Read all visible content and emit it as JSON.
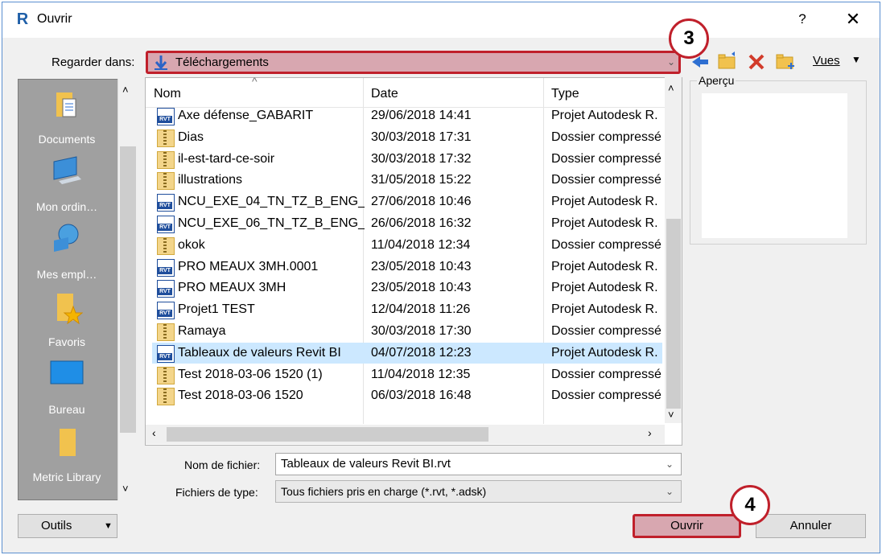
{
  "window": {
    "app_icon": "R",
    "title": "Ouvrir",
    "help_glyph": "?",
    "close_glyph": "✕"
  },
  "lookin": {
    "label": "Regarder dans:",
    "value": "Téléchargements",
    "icon": "download-arrow-icon"
  },
  "toolbar": {
    "views_label": "Vues",
    "icons": [
      "back-arrow-icon",
      "up-folder-icon",
      "delete-icon",
      "new-folder-icon"
    ]
  },
  "annotations": {
    "step3": "3",
    "step4": "4"
  },
  "places": [
    {
      "label": "Documents",
      "icon": "documents-icon"
    },
    {
      "label": "Mon ordin…",
      "icon": "computer-icon"
    },
    {
      "label": "Mes empl…",
      "icon": "network-icon"
    },
    {
      "label": "Favoris",
      "icon": "favorites-icon"
    },
    {
      "label": "Bureau",
      "icon": "desktop-icon"
    },
    {
      "label": "Metric Library",
      "icon": "folder-icon"
    }
  ],
  "filelist": {
    "columns": [
      "Nom",
      "Date",
      "Type"
    ],
    "sort_indicator": "^",
    "rows": [
      {
        "name": "Axe défense_GABARIT",
        "date": "29/06/2018 14:41",
        "type": "Projet Autodesk R.",
        "icon": "rvt",
        "selected": false
      },
      {
        "name": "Dias",
        "date": "30/03/2018 17:31",
        "type": "Dossier compressé",
        "icon": "zip",
        "selected": false
      },
      {
        "name": "il-est-tard-ce-soir",
        "date": "30/03/2018 17:32",
        "type": "Dossier compressé",
        "icon": "zip",
        "selected": false
      },
      {
        "name": "illustrations",
        "date": "31/05/2018 15:22",
        "type": "Dossier compressé",
        "icon": "zip",
        "selected": false
      },
      {
        "name": "NCU_EXE_04_TN_TZ_B_ENG_...",
        "date": "27/06/2018 10:46",
        "type": "Projet Autodesk R.",
        "icon": "rvt",
        "selected": false
      },
      {
        "name": "NCU_EXE_06_TN_TZ_B_ENG_...",
        "date": "26/06/2018 16:32",
        "type": "Projet Autodesk R.",
        "icon": "rvt",
        "selected": false
      },
      {
        "name": "okok",
        "date": "11/04/2018 12:34",
        "type": "Dossier compressé",
        "icon": "zip",
        "selected": false
      },
      {
        "name": "PRO MEAUX 3MH.0001",
        "date": "23/05/2018 10:43",
        "type": "Projet Autodesk R.",
        "icon": "rvt",
        "selected": false
      },
      {
        "name": "PRO MEAUX 3MH",
        "date": "23/05/2018 10:43",
        "type": "Projet Autodesk R.",
        "icon": "rvt",
        "selected": false
      },
      {
        "name": "Projet1 TEST",
        "date": "12/04/2018 11:26",
        "type": "Projet Autodesk R.",
        "icon": "rvt",
        "selected": false
      },
      {
        "name": "Ramaya",
        "date": "30/03/2018 17:30",
        "type": "Dossier compressé",
        "icon": "zip",
        "selected": false
      },
      {
        "name": "Tableaux de valeurs Revit BI",
        "date": "04/07/2018 12:23",
        "type": "Projet Autodesk R.",
        "icon": "rvt",
        "selected": true
      },
      {
        "name": "Test 2018-03-06 1520 (1)",
        "date": "11/04/2018 12:35",
        "type": "Dossier compressé",
        "icon": "zip",
        "selected": false
      },
      {
        "name": "Test 2018-03-06 1520",
        "date": "06/03/2018 16:48",
        "type": "Dossier compressé",
        "icon": "zip",
        "selected": false
      }
    ]
  },
  "preview": {
    "label": "Aperçu"
  },
  "filename": {
    "label": "Nom de fichier:",
    "value": "Tableaux de valeurs Revit BI.rvt"
  },
  "filetype": {
    "label": "Fichiers de type:",
    "value": "Tous fichiers pris en charge  (*.rvt, *.adsk)"
  },
  "buttons": {
    "tools": "Outils",
    "open": "Ouvrir",
    "cancel": "Annuler"
  },
  "colors": {
    "highlight_red": "#c0202b",
    "highlight_fill": "#d8a7b0",
    "selection": "#cce8ff"
  }
}
